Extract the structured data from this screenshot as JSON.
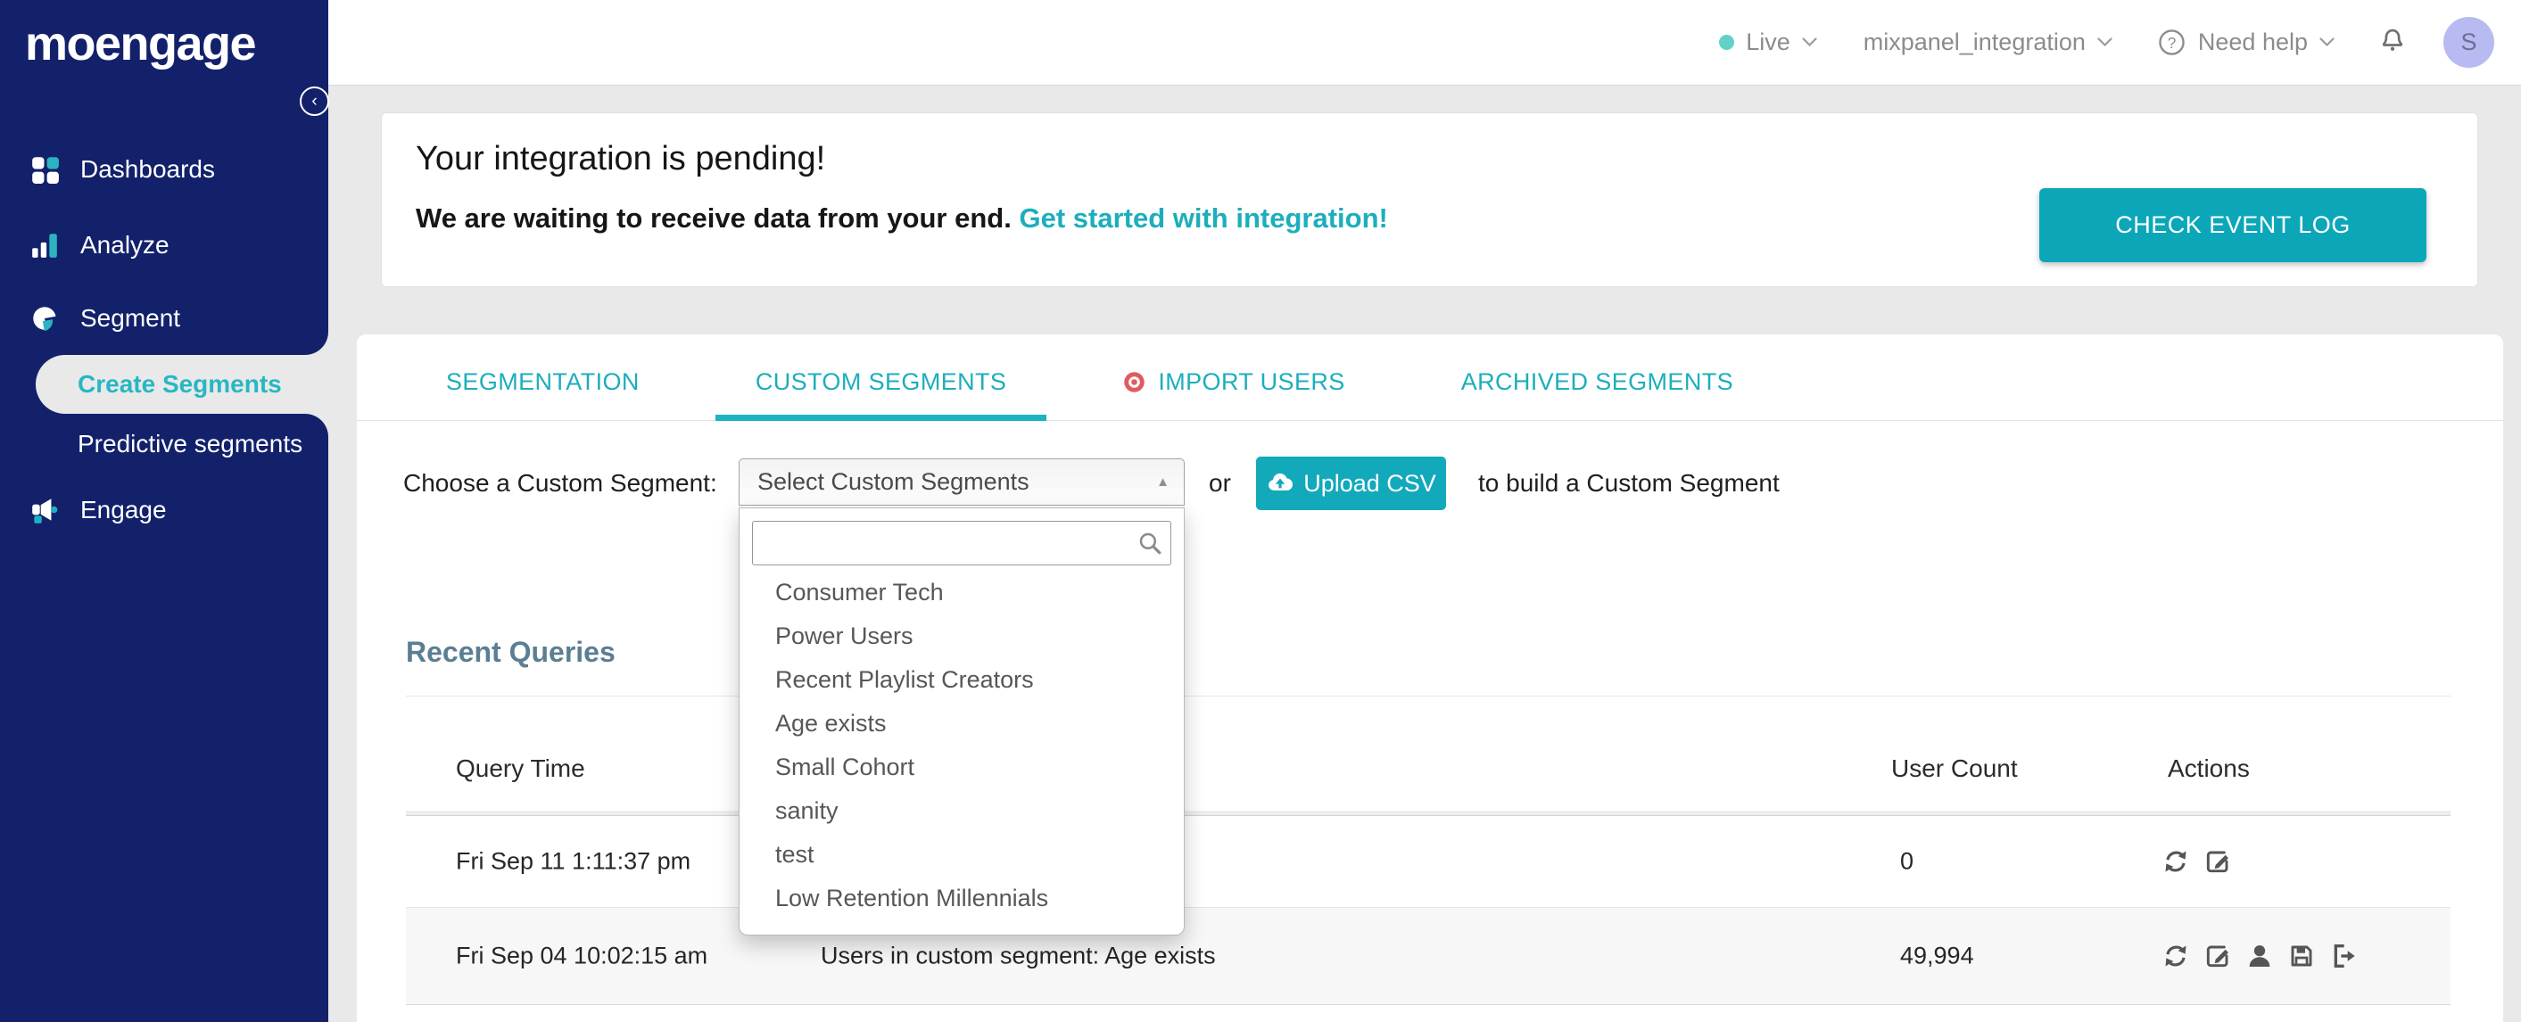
{
  "app": {
    "logo_text": "moengage"
  },
  "sidebar": {
    "items": [
      {
        "label": "Dashboards"
      },
      {
        "label": "Analyze"
      },
      {
        "label": "Segment"
      },
      {
        "label": "Create Segments",
        "active": true
      },
      {
        "label": "Predictive segments"
      },
      {
        "label": "Engage"
      }
    ]
  },
  "header": {
    "env_label": "Live",
    "project_name": "mixpanel_integration",
    "help_label": "Need help",
    "avatar_initial": "S"
  },
  "banner": {
    "title": "Your integration is pending!",
    "message": "We are waiting to receive data from your end.",
    "link_text": "Get started with integration!",
    "button_label": "CHECK EVENT LOG"
  },
  "tabs": {
    "items": [
      {
        "label": "SEGMENTATION"
      },
      {
        "label": "CUSTOM SEGMENTS",
        "active": true
      },
      {
        "label": "IMPORT USERS"
      },
      {
        "label": "ARCHIVED SEGMENTS"
      }
    ]
  },
  "segment_picker": {
    "label": "Choose a Custom Segment:",
    "select_value": "Select Custom Segments",
    "or_text": "or",
    "upload_button_label": "Upload CSV",
    "suffix_text": "to build a Custom Segment",
    "search_placeholder": "",
    "options": [
      "Consumer Tech",
      "Power Users",
      "Recent Playlist Creators",
      "Age exists",
      "Small Cohort",
      "sanity",
      "test",
      "Low Retention Millennials"
    ]
  },
  "recent_queries": {
    "title": "Recent Queries",
    "columns": {
      "query_time": "Query Time",
      "user_count": "User Count",
      "actions": "Actions"
    },
    "rows": [
      {
        "query_time": "Fri Sep 11 1:11:37 pm",
        "description": "",
        "user_count": "0"
      },
      {
        "query_time": "Fri Sep 04 10:02:15 am",
        "description": "Users in custom segment: Age exists",
        "user_count": "49,994"
      }
    ]
  },
  "colors": {
    "sidebar_navy": "#13216b",
    "teal_text": "#1caebc",
    "teal_button": "#0ba7b9",
    "active_item_teal": "#27b7c4",
    "live_dot": "#62d2c8",
    "import_users_red": "#e05b5e",
    "heading_slate": "#5b7e93"
  }
}
